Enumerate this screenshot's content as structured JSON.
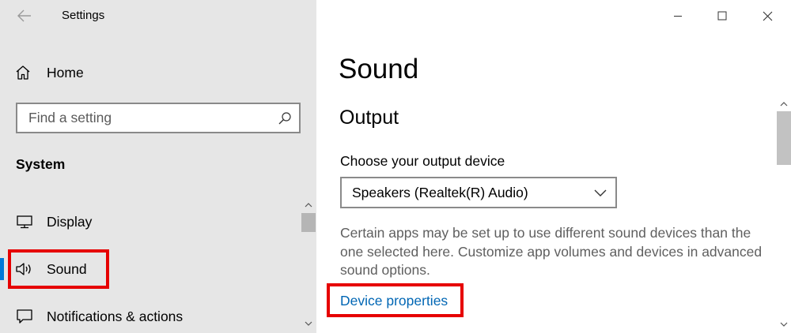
{
  "window": {
    "title": "Settings",
    "controls": [
      "minimize-icon",
      "maximize-icon",
      "close-icon"
    ]
  },
  "sidebar": {
    "home_label": "Home",
    "search_placeholder": "Find a setting",
    "section_title": "System",
    "items": [
      {
        "label": "Display",
        "icon": "monitor-icon"
      },
      {
        "label": "Sound",
        "icon": "speaker-icon",
        "selected": true
      },
      {
        "label": "Notifications & actions",
        "icon": "notification-icon"
      }
    ]
  },
  "main": {
    "title": "Sound",
    "section": "Output",
    "device_label": "Choose your output device",
    "device_value": "Speakers (Realtek(R) Audio)",
    "description": "Certain apps may be set up to use different sound devices than the one selected here. Customize app volumes and devices in advanced sound options.",
    "link": "Device properties"
  },
  "colors": {
    "accent": "#0078d7",
    "link": "#0066b4",
    "highlight": "#e60000",
    "sidebar_bg": "#e6e6e6"
  }
}
